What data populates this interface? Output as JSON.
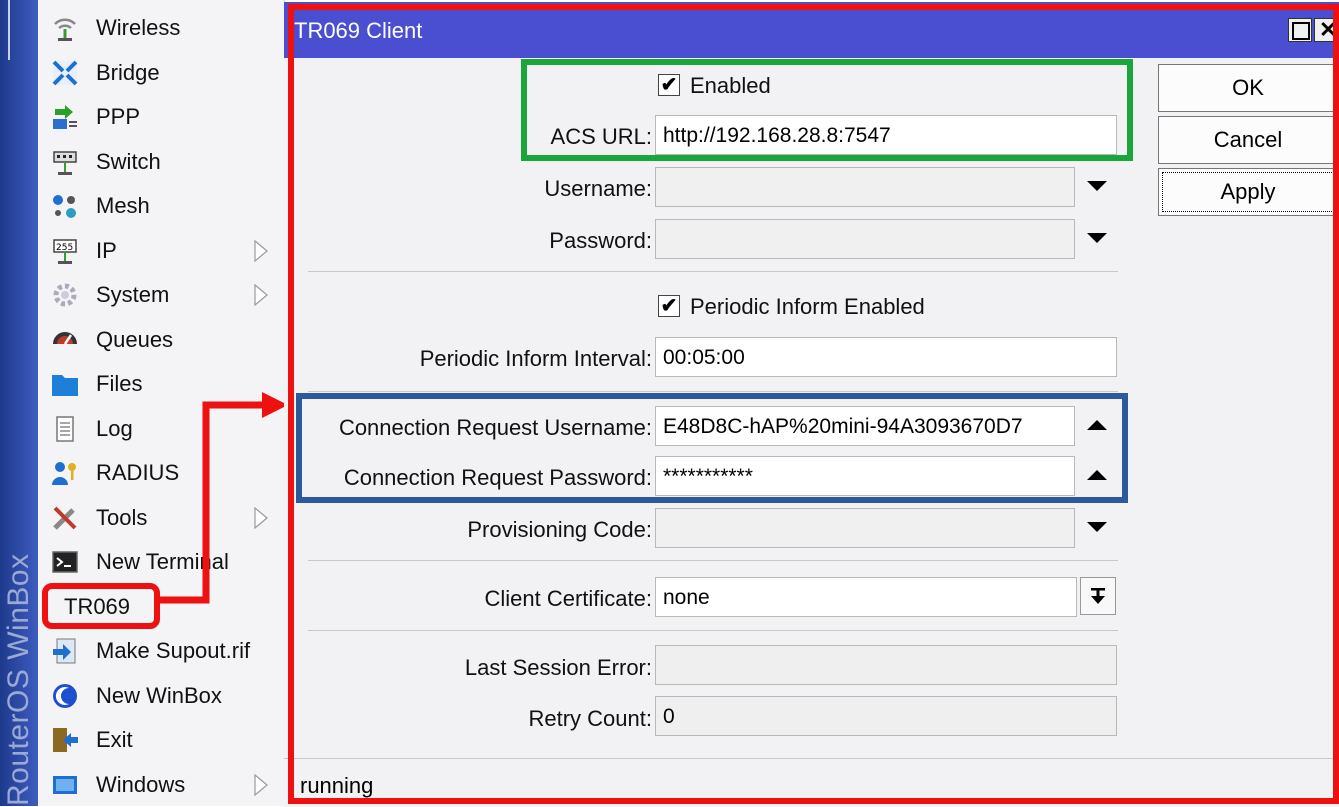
{
  "brand": {
    "text": "RouterOS WinBox"
  },
  "sidebar": {
    "items": [
      {
        "label": "Wireless",
        "icon": "wireless-icon",
        "submenu": false
      },
      {
        "label": "Bridge",
        "icon": "bridge-icon",
        "submenu": false
      },
      {
        "label": "PPP",
        "icon": "ppp-icon",
        "submenu": false
      },
      {
        "label": "Switch",
        "icon": "switch-icon",
        "submenu": false
      },
      {
        "label": "Mesh",
        "icon": "mesh-icon",
        "submenu": false
      },
      {
        "label": "IP",
        "icon": "ip-icon",
        "submenu": true
      },
      {
        "label": "System",
        "icon": "system-icon",
        "submenu": true
      },
      {
        "label": "Queues",
        "icon": "queues-icon",
        "submenu": false
      },
      {
        "label": "Files",
        "icon": "files-icon",
        "submenu": false
      },
      {
        "label": "Log",
        "icon": "log-icon",
        "submenu": false
      },
      {
        "label": "RADIUS",
        "icon": "radius-icon",
        "submenu": false
      },
      {
        "label": "Tools",
        "icon": "tools-icon",
        "submenu": true
      },
      {
        "label": "New Terminal",
        "icon": "terminal-icon",
        "submenu": false
      },
      {
        "label": "TR069",
        "icon": "",
        "submenu": false
      },
      {
        "label": "Make Supout.rif",
        "icon": "supout-icon",
        "submenu": false
      },
      {
        "label": "New WinBox",
        "icon": "winbox-icon",
        "submenu": false
      },
      {
        "label": "Exit",
        "icon": "exit-icon",
        "submenu": false
      },
      {
        "label": "Windows",
        "icon": "windows-icon",
        "submenu": true
      }
    ]
  },
  "window": {
    "title": "TR069 Client",
    "enabled": {
      "label": "Enabled",
      "checked": true
    },
    "acs_url": {
      "label": "ACS URL:",
      "value": "http://192.168.28.8:7547"
    },
    "username": {
      "label": "Username:",
      "value": ""
    },
    "password": {
      "label": "Password:",
      "value": ""
    },
    "periodic_inform_enabled": {
      "label": "Periodic Inform Enabled",
      "checked": true
    },
    "periodic_inform_interval": {
      "label": "Periodic Inform Interval:",
      "value": "00:05:00"
    },
    "conn_req_username": {
      "label": "Connection Request Username:",
      "value": "E48D8C-hAP%20mini-94A3093670D7"
    },
    "conn_req_password": {
      "label": "Connection Request Password:",
      "value": "***********"
    },
    "provisioning_code": {
      "label": "Provisioning Code:",
      "value": ""
    },
    "client_certificate": {
      "label": "Client Certificate:",
      "value": "none"
    },
    "last_session_error": {
      "label": "Last Session Error:",
      "value": ""
    },
    "retry_count": {
      "label": "Retry Count:",
      "value": "0"
    },
    "buttons": {
      "ok": "OK",
      "cancel": "Cancel",
      "apply": "Apply"
    },
    "status": "running"
  },
  "colors": {
    "titlebar": "#4a4fd2",
    "highlight_red": "#ee1111",
    "highlight_green": "#1aa63a",
    "highlight_blue": "#2a5a9a"
  }
}
